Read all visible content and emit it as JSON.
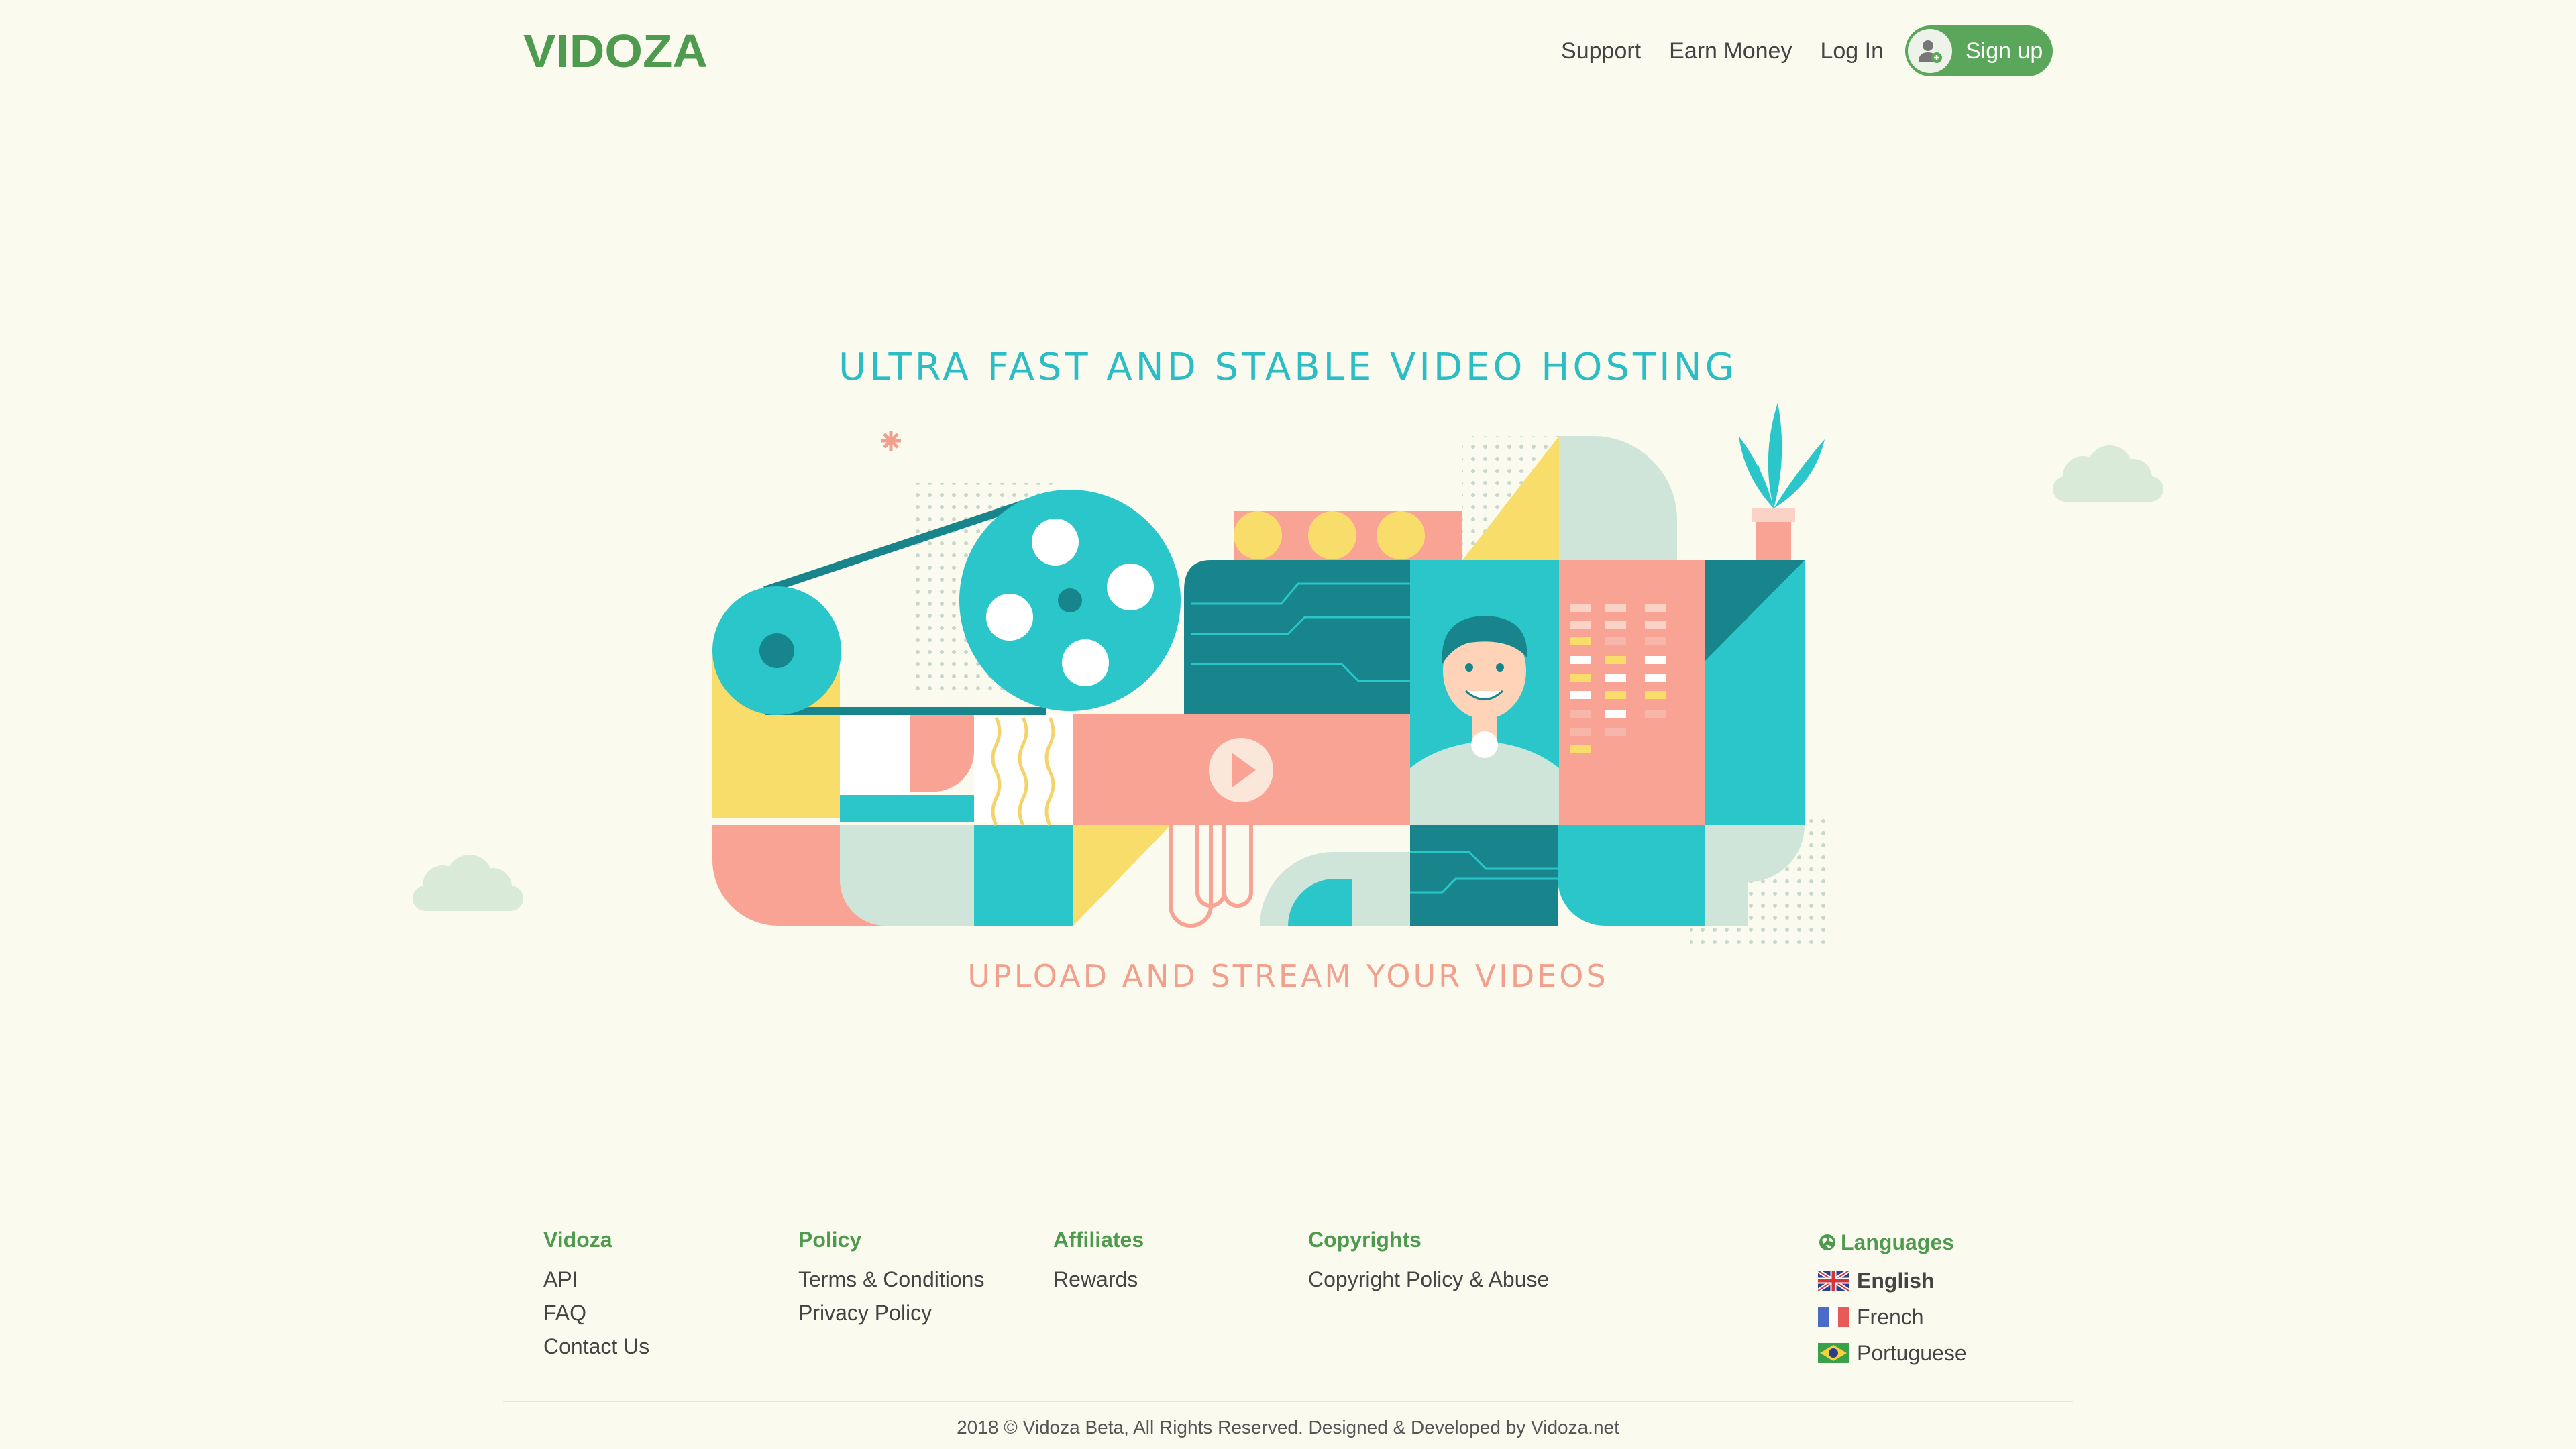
{
  "header": {
    "logo_text": "VIDOZA",
    "nav": {
      "support": "Support",
      "earn_money": "Earn Money",
      "login": "Log In",
      "signup": "Sign up"
    }
  },
  "hero": {
    "title": "ULTRA FAST AND STABLE VIDEO HOSTING",
    "subtitle": "UPLOAD AND STREAM YOUR VIDEOS"
  },
  "footer": {
    "columns": [
      {
        "heading": "Vidoza",
        "links": [
          "API",
          "FAQ",
          "Contact Us"
        ]
      },
      {
        "heading": "Policy",
        "links": [
          "Terms & Conditions",
          "Privacy Policy"
        ]
      },
      {
        "heading": "Affiliates",
        "links": [
          "Rewards"
        ]
      },
      {
        "heading": "Copyrights",
        "links": [
          "Copyright Policy & Abuse"
        ]
      }
    ],
    "languages": {
      "heading": "Languages",
      "items": [
        "English",
        "French",
        "Portuguese"
      ],
      "selected": "English"
    },
    "copyright": "2018 © Vidoza Beta, All Rights Reserved. Designed & Developed by Vidoza.net"
  },
  "colors": {
    "brand_green": "#4e9a4e",
    "accent_teal": "#2bbcc4",
    "accent_salmon": "#f2a08e",
    "background": "#fbfaef"
  },
  "icons": [
    "user-add-icon",
    "globe-icon",
    "play-icon",
    "uk-flag-icon",
    "france-flag-icon",
    "brazil-flag-icon"
  ]
}
